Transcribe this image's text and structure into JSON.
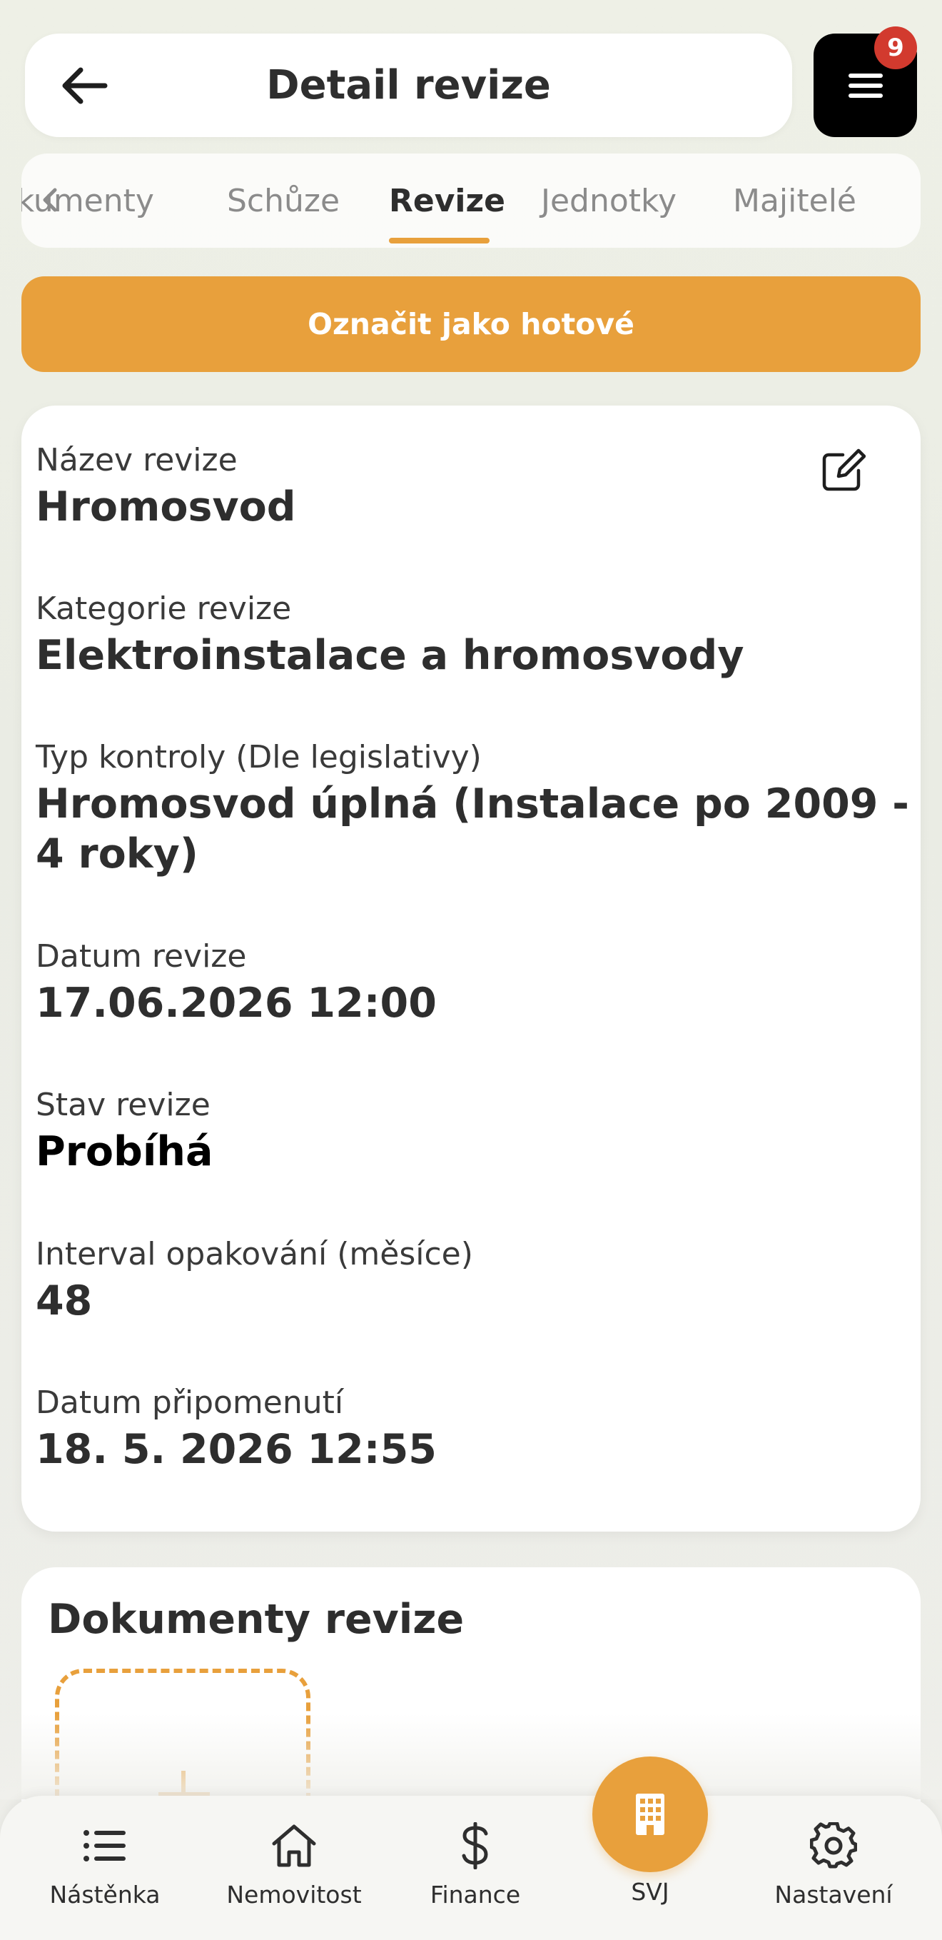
{
  "header": {
    "title": "Detail revize",
    "badge_count": "9"
  },
  "tabs": {
    "items": [
      {
        "label": "Dokumenty"
      },
      {
        "label": "Schůze"
      },
      {
        "label": "Revize",
        "active": true
      },
      {
        "label": "Jednotky"
      },
      {
        "label": "Majitelé"
      }
    ]
  },
  "actions": {
    "mark_done_label": "Označit jako hotové"
  },
  "detail": {
    "name_label": "Název revize",
    "name_value": "Hromosvod",
    "category_label": "Kategorie revize",
    "category_value": "Elektroinstalace a hromosvody",
    "type_label": "Typ kontroly (Dle legislativy)",
    "type_value_line1": "Hromosvod úplná (Instalace po 2009 -",
    "type_value_line2": "4 roky)",
    "date_label": "Datum revize",
    "date_value": "17.06.2026 12:00",
    "status_label": "Stav revize",
    "status_value": "Probíhá",
    "interval_label": "Interval opakování (měsíce)",
    "interval_value": "48",
    "reminder_label": "Datum připomenutí",
    "reminder_value": "18. 5. 2026 12:55"
  },
  "documents": {
    "title": "Dokumenty revize"
  },
  "bottom_nav": {
    "items": [
      {
        "label": "Nástěnka",
        "icon": "list-icon"
      },
      {
        "label": "Nemovitost",
        "icon": "house-icon"
      },
      {
        "label": "Finance",
        "icon": "dollar-icon"
      },
      {
        "label": "SVJ",
        "icon": "building-icon"
      },
      {
        "label": "Nastavení",
        "icon": "gear-icon"
      }
    ]
  },
  "colors": {
    "accent": "#e8a03c",
    "badge": "#d23a2e",
    "menu_bg": "#000000"
  }
}
